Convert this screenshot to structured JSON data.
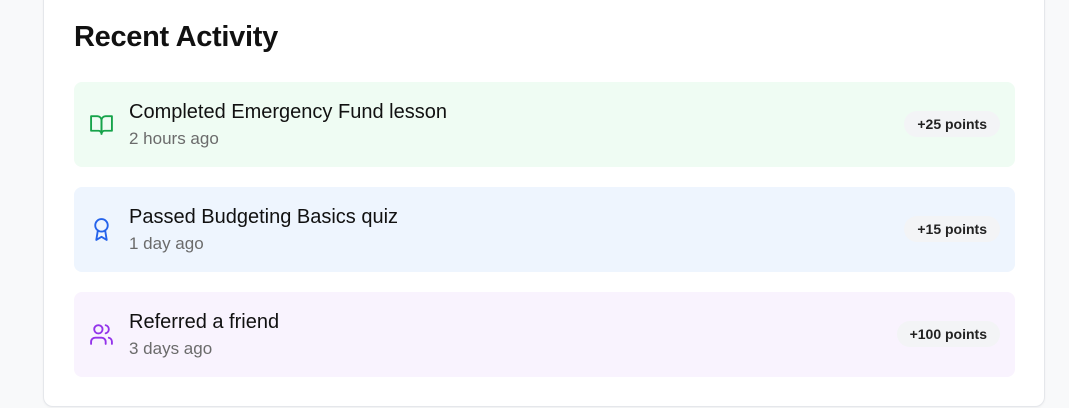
{
  "section": {
    "title": "Recent Activity"
  },
  "activities": [
    {
      "title": "Completed Emergency Fund lesson",
      "time": "2 hours ago",
      "points": "+25 points",
      "icon": "book-open-icon",
      "background": "#effcf3",
      "icon_color": "#16a34a"
    },
    {
      "title": "Passed Budgeting Basics quiz",
      "time": "1 day ago",
      "points": "+15 points",
      "icon": "award-icon",
      "background": "#eef5fe",
      "icon_color": "#2563eb"
    },
    {
      "title": "Referred a friend",
      "time": "3 days ago",
      "points": "+100 points",
      "icon": "users-icon",
      "background": "#f9f3fe",
      "icon_color": "#9333ea"
    }
  ]
}
